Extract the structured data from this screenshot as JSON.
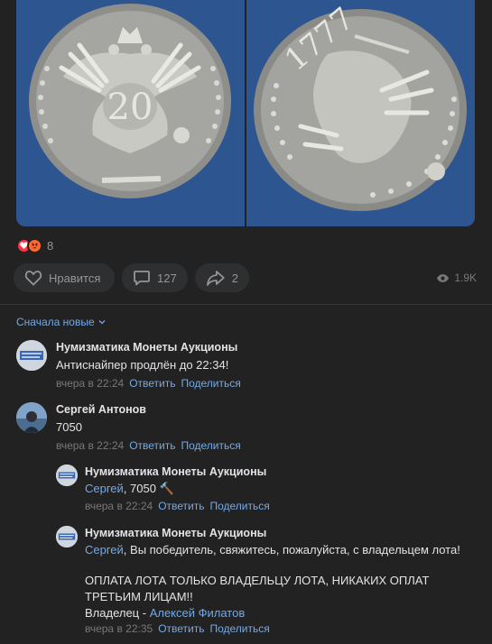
{
  "post": {
    "reactions": {
      "count": "8"
    },
    "actions": {
      "like_label": "Нравится",
      "comments_count": "127",
      "shares_count": "2",
      "views_count": "1.9K"
    }
  },
  "comments_section": {
    "sort_label": "Сначала новые",
    "reply_label": "Ответить",
    "share_label": "Поделиться",
    "comments": [
      {
        "author": "Нумизматика Монеты Аукционы",
        "text": "Антиснайпер продлён до 22:34!",
        "time": "вчера в 22:24"
      },
      {
        "author": "Сергей Антонов",
        "text": "7050",
        "time": "вчера в 22:24"
      },
      {
        "author": "Нумизматика Монеты Аукционы",
        "mention": "Сергей",
        "text": ", 7050 🔨",
        "time": "вчера в 22:24"
      },
      {
        "author": "Нумизматика Монеты Аукционы",
        "mention": "Сергей",
        "text": ", Вы победитель, свяжитесь, пожалуйста, с владельцем лота!",
        "text_line2": "ОПЛАТА ЛОТА ТОЛЬКО ВЛАДЕЛЬЦУ ЛОТА, НИКАКИХ ОПЛАТ",
        "text_line3": "ТРЕТЬИМ ЛИЦАМ!!",
        "owner_prefix": "Владелец - ",
        "owner_name": "Алексей Филатов",
        "time": "вчера в 22:35"
      }
    ]
  },
  "colors": {
    "background": "#222222",
    "text": "#e1e3e6",
    "secondary": "#939699",
    "accent_link": "#71aaeb",
    "photo_bg": "#2b4f86"
  }
}
